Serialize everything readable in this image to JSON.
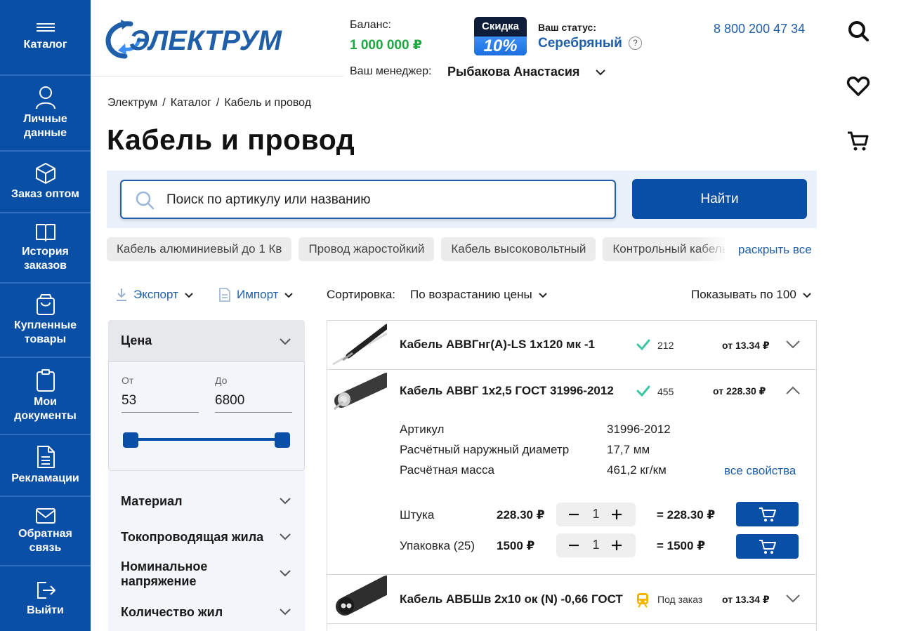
{
  "sidebar": {
    "items": [
      {
        "label": "Каталог",
        "icon": "menu-icon"
      },
      {
        "label": "Личные\nданные",
        "icon": "user-icon"
      },
      {
        "label": "Заказ оптом",
        "icon": "box-icon"
      },
      {
        "label": "История\nзаказов",
        "icon": "book-icon"
      },
      {
        "label": "Купленные\nтовары",
        "icon": "bag-icon"
      },
      {
        "label": "Мои\nдокументы",
        "icon": "clipboard-icon"
      },
      {
        "label": "Рекламации",
        "icon": "document-icon"
      },
      {
        "label": "Обратная\nсвязь",
        "icon": "mail-icon"
      },
      {
        "label": "Выйти",
        "icon": "logout-icon"
      }
    ]
  },
  "header": {
    "logo_text": "ЭЛЕКТРУМ",
    "balance_label": "Баланс:",
    "balance_value": "1 000 000 ₽",
    "discount_label": "Скидка",
    "discount_value": "10%",
    "status_label": "Ваш статус:",
    "status_value": "Серебряный",
    "help": "?",
    "phone": "8 800 200 47 34",
    "manager_label": "Ваш менеджер:",
    "manager_name": "Рыбакова Анастасия",
    "right_icons": [
      "search-icon",
      "heart-icon",
      "cart-icon"
    ]
  },
  "breadcrumbs": [
    "Электрум",
    "Каталог",
    "Кабель и провод"
  ],
  "breadcrumb_sep": "/",
  "page_title": "Кабель и провод",
  "search": {
    "placeholder": "Поиск по артикулу или названию",
    "button": "Найти"
  },
  "chips": [
    "Кабель алюминиевый до 1 Кв",
    "Провод жаростойкий",
    "Кабель высоковольтный",
    "Контрольный кабель"
  ],
  "expand_all": "раскрыть все",
  "toolbar": {
    "export": "Экспорт",
    "import": "Импорт",
    "sort_label": "Сортировка:",
    "sort_value": "По возрастанию цены",
    "show_per_page": "Показывать по 100"
  },
  "filters": {
    "price": {
      "title": "Цена",
      "from_label": "От",
      "to_label": "До",
      "from_value": "53",
      "to_value": "6800"
    },
    "collapsed": [
      "Материал",
      "Токопроводящая жила",
      "Номинальное\nнапряжение",
      "Количество жил"
    ]
  },
  "products": [
    {
      "name": "Кабель АВВГнг(А)-LS 1х120 мк -1",
      "stock": "212",
      "availability": "in-stock",
      "price": "от 13.34 ₽"
    },
    {
      "name": "Кабель АВВГ 1х2,5 ГОСТ 31996-2012",
      "stock": "455",
      "availability": "in-stock",
      "price": "от 228.30 ₽",
      "expanded": true,
      "props": [
        {
          "label": "Артикул",
          "value": "31996-2012"
        },
        {
          "label": "Расчётный наружный диаметр",
          "value": "17,7 мм"
        },
        {
          "label": "Расчётная масса",
          "value": "461,2 кг/км"
        }
      ],
      "all_props": "все свойства",
      "units": [
        {
          "label": "Штука",
          "price": "228.30 ₽",
          "qty": "1",
          "total": "= 228.30 ₽"
        },
        {
          "label": "Упаковка (25)",
          "price": "1500 ₽",
          "qty": "1",
          "total": "= 1500 ₽"
        }
      ]
    },
    {
      "name": "Кабель АВБШв 2х10 ок (N) -0,66 ГОСТ",
      "stock": "Под заказ",
      "availability": "on-order",
      "price": "от 13.34 ₽"
    }
  ],
  "colors": {
    "primary": "#0a4fa6",
    "link": "#1f5ea8",
    "balance": "#1fa841",
    "check": "#3cc6a4",
    "order": "#f4b400"
  }
}
